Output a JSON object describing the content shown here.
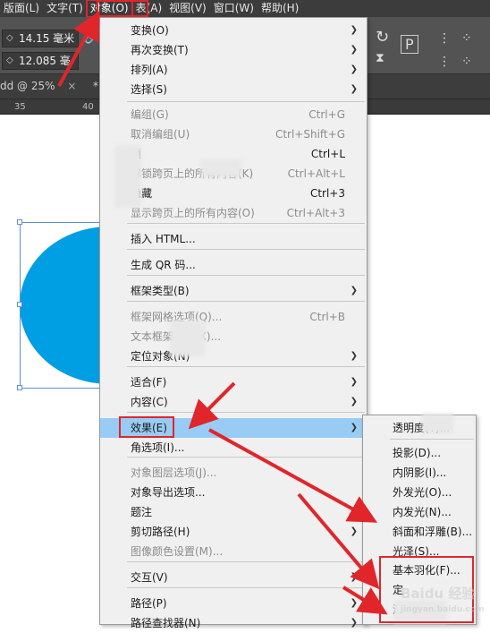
{
  "menubar": {
    "items": [
      "版面(L)",
      "文字(T)",
      "对象(O)",
      "表(A)",
      "视图(V)",
      "窗口(W)",
      "帮助(H)"
    ],
    "active_index": 2
  },
  "toolbar": {
    "field_a": "14.15 毫米",
    "field_b": "12.085 毫"
  },
  "document": {
    "tab_label": "dd @ 25%",
    "tab_close": "×",
    "tab_marker": "*"
  },
  "ruler": {
    "ticks": [
      "35",
      "40"
    ]
  },
  "object_menu": {
    "items": [
      {
        "label": "变换(O)",
        "shortcut": "",
        "submenu": true,
        "disabled": false
      },
      {
        "label": "再次变换(T)",
        "shortcut": "",
        "submenu": true,
        "disabled": false
      },
      {
        "label": "排列(A)",
        "shortcut": "",
        "submenu": true,
        "disabled": false
      },
      {
        "label": "选择(S)",
        "shortcut": "",
        "submenu": true,
        "disabled": false
      },
      {
        "label": "编组(G)",
        "shortcut": "Ctrl+G",
        "submenu": false,
        "disabled": true
      },
      {
        "label": "取消编组(U)",
        "shortcut": "Ctrl+Shift+G",
        "submenu": false,
        "disabled": true
      },
      {
        "label": "锁",
        "shortcut": "Ctrl+L",
        "submenu": false,
        "disabled": false
      },
      {
        "label": "解锁跨页上的所有内容(K)",
        "shortcut": "Ctrl+Alt+L",
        "submenu": false,
        "disabled": true
      },
      {
        "label": "隐藏",
        "shortcut": "Ctrl+3",
        "submenu": false,
        "disabled": false
      },
      {
        "label": "显示跨页上的所有内容(O)",
        "shortcut": "Ctrl+Alt+3",
        "submenu": false,
        "disabled": true
      },
      {
        "label": "插入 HTML...",
        "shortcut": "",
        "submenu": false,
        "disabled": false
      },
      {
        "label": "生成 QR 码...",
        "shortcut": "",
        "submenu": false,
        "disabled": false
      },
      {
        "label": "框架类型(B)",
        "shortcut": "",
        "submenu": true,
        "disabled": false
      },
      {
        "label": "框架网格选项(Q)...",
        "shortcut": "Ctrl+B",
        "submenu": false,
        "disabled": true
      },
      {
        "label": "文本框架选项(X)...",
        "shortcut": "",
        "submenu": false,
        "disabled": true
      },
      {
        "label": "定位对象(N)",
        "shortcut": "",
        "submenu": true,
        "disabled": false
      },
      {
        "label": "适合(F)",
        "shortcut": "",
        "submenu": true,
        "disabled": false
      },
      {
        "label": "内容(C)",
        "shortcut": "",
        "submenu": true,
        "disabled": false
      },
      {
        "label": "效果(E)",
        "shortcut": "",
        "submenu": true,
        "disabled": false
      },
      {
        "label": "角选项(I)...",
        "shortcut": "",
        "submenu": false,
        "disabled": false
      },
      {
        "label": "对象图层选项(J)...",
        "shortcut": "",
        "submenu": false,
        "disabled": true
      },
      {
        "label": "对象导出选项...",
        "shortcut": "",
        "submenu": false,
        "disabled": false
      },
      {
        "label": "题注",
        "shortcut": "",
        "submenu": true,
        "disabled": false
      },
      {
        "label": "剪切路径(H)",
        "shortcut": "",
        "submenu": true,
        "disabled": false
      },
      {
        "label": "图像颜色设置(M)...",
        "shortcut": "",
        "submenu": false,
        "disabled": true
      },
      {
        "label": "交互(V)",
        "shortcut": "",
        "submenu": true,
        "disabled": false
      },
      {
        "label": "路径(P)",
        "shortcut": "",
        "submenu": true,
        "disabled": false
      },
      {
        "label": "路径查找器(N)",
        "shortcut": "",
        "submenu": true,
        "disabled": false
      }
    ]
  },
  "effects_menu": {
    "items": [
      "透明度(T)...",
      "投影(D)...",
      "内阴影(I)...",
      "外发光(O)...",
      "内发光(N)...",
      "斜面和浮雕(B)...",
      "光泽(S)...",
      "基本羽化(F)...",
      "定",
      "渐"
    ]
  },
  "colors": {
    "highlight": "#99ccf5",
    "annotation_red": "#e0262b",
    "shape_blue": "#009ee3"
  },
  "watermark": {
    "text": "Baidu 经验",
    "sub": "jingyan.baidu.com"
  }
}
